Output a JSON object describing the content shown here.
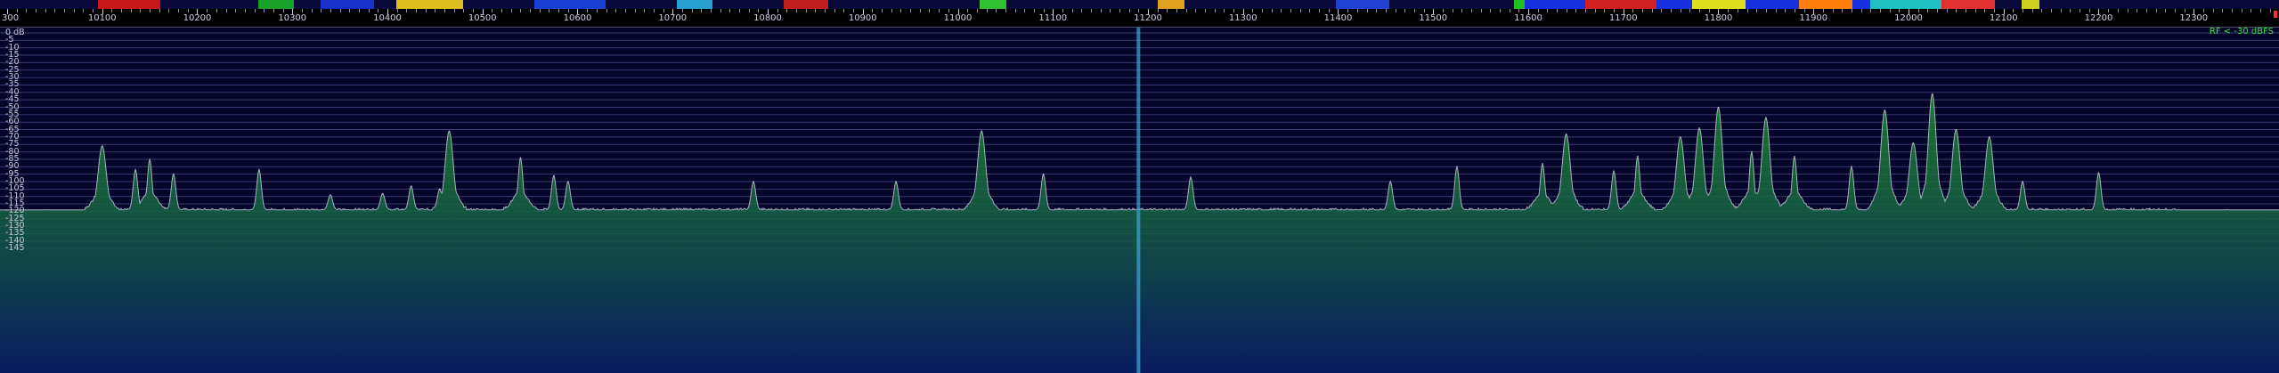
{
  "ruler": {
    "left_edge_label": "300",
    "freq_labels": [
      "10100",
      "10200",
      "10300",
      "10400",
      "10500",
      "10600",
      "10700",
      "10800",
      "10900",
      "11000",
      "11100",
      "11200",
      "11300",
      "11400",
      "11500",
      "11600",
      "11700",
      "11800",
      "11900",
      "12000",
      "12100",
      "12200",
      "12300"
    ]
  },
  "db_axis": {
    "labels": [
      "0 dB",
      "-5",
      "-10",
      "-15",
      "-20",
      "-25",
      "-30",
      "-35",
      "-40",
      "-45",
      "-50",
      "-55",
      "-60",
      "-65",
      "-70",
      "-75",
      "-80",
      "-85",
      "-90",
      "-95",
      "-100",
      "-105",
      "-110",
      "-115",
      "-120",
      "-125",
      "-130",
      "-135",
      "-140",
      "-145"
    ]
  },
  "rf_status": "RF < -30 dBFS",
  "colors": {
    "background": "#05052a",
    "grid": "#3a3a72",
    "trace": "#d8d8ec",
    "fill_top": "#1f8a2c",
    "fill_bottom": "#0a1f6a",
    "marker": "#3aa0d0",
    "rf_text": "#38e838"
  },
  "tuned_marker": {
    "frequency_khz": 11190
  },
  "chart_data": {
    "type": "area",
    "title": "",
    "xlabel": "",
    "ylabel": "",
    "xlim": [
      10000,
      12390
    ],
    "ylim": [
      -145,
      0
    ],
    "grid": true,
    "noise_floor_db": -119,
    "passband_khz": [
      10040,
      12335
    ],
    "signals": [
      {
        "f": 10100,
        "db": -76
      },
      {
        "f": 10135,
        "db": -92
      },
      {
        "f": 10150,
        "db": -85
      },
      {
        "f": 10175,
        "db": -95
      },
      {
        "f": 10265,
        "db": -92
      },
      {
        "f": 10340,
        "db": -109
      },
      {
        "f": 10395,
        "db": -108
      },
      {
        "f": 10425,
        "db": -103
      },
      {
        "f": 10455,
        "db": -105
      },
      {
        "f": 10465,
        "db": -66
      },
      {
        "f": 10540,
        "db": -84
      },
      {
        "f": 10575,
        "db": -96
      },
      {
        "f": 10590,
        "db": -100
      },
      {
        "f": 10785,
        "db": -100
      },
      {
        "f": 10935,
        "db": -100
      },
      {
        "f": 11025,
        "db": -66
      },
      {
        "f": 11090,
        "db": -95
      },
      {
        "f": 11245,
        "db": -97
      },
      {
        "f": 11455,
        "db": -100
      },
      {
        "f": 11525,
        "db": -90
      },
      {
        "f": 11615,
        "db": -88
      },
      {
        "f": 11640,
        "db": -68
      },
      {
        "f": 11690,
        "db": -93
      },
      {
        "f": 11715,
        "db": -83
      },
      {
        "f": 11760,
        "db": -70
      },
      {
        "f": 11780,
        "db": -64
      },
      {
        "f": 11800,
        "db": -50
      },
      {
        "f": 11835,
        "db": -80
      },
      {
        "f": 11850,
        "db": -57
      },
      {
        "f": 11880,
        "db": -83
      },
      {
        "f": 11940,
        "db": -90
      },
      {
        "f": 11975,
        "db": -52
      },
      {
        "f": 12005,
        "db": -74
      },
      {
        "f": 12025,
        "db": -41
      },
      {
        "f": 12050,
        "db": -65
      },
      {
        "f": 12085,
        "db": -70
      },
      {
        "f": 12120,
        "db": -100
      },
      {
        "f": 12200,
        "db": -94
      }
    ]
  }
}
